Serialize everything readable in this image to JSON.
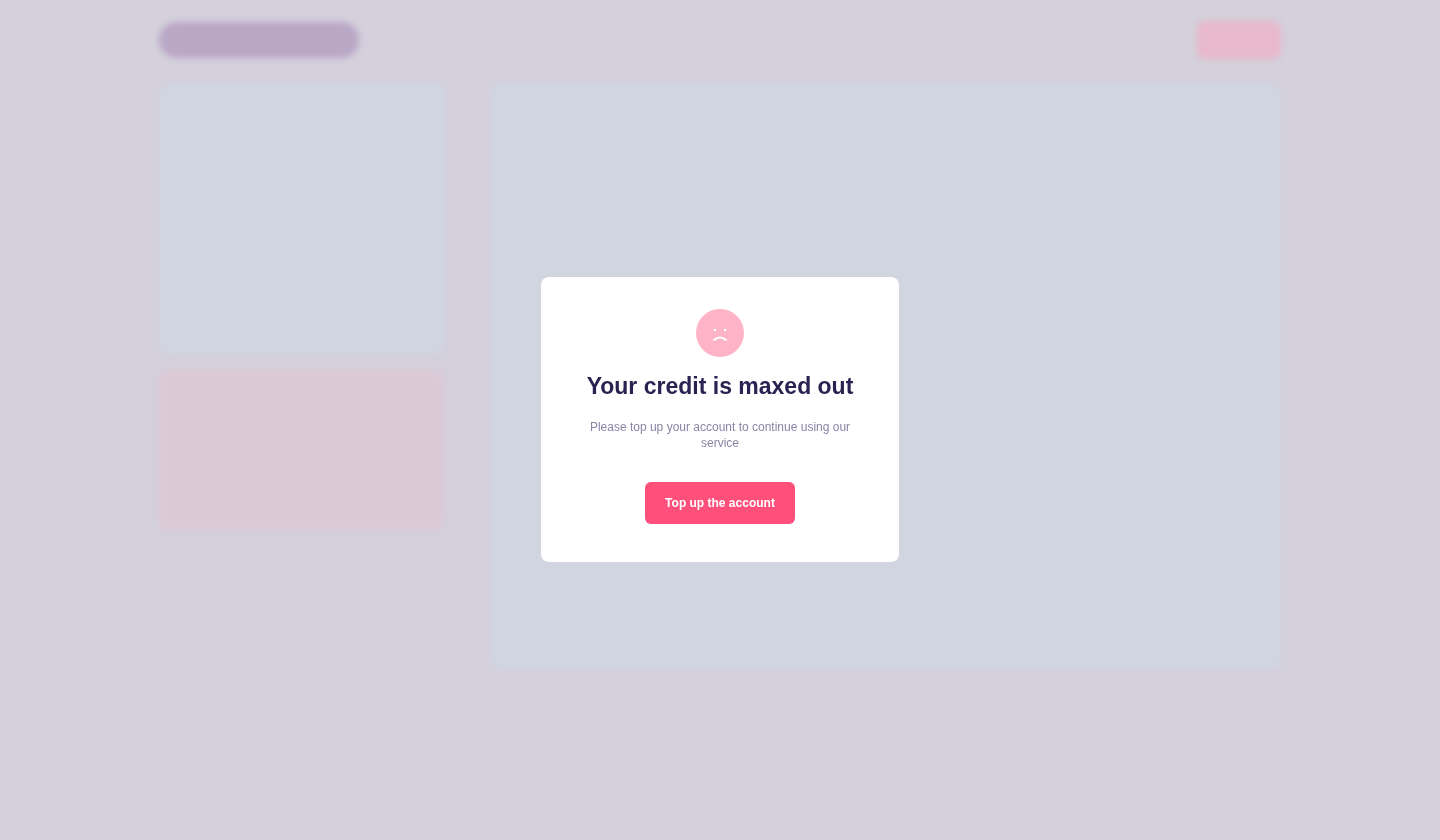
{
  "modal": {
    "title": "Your credit is maxed out",
    "message": "Please top up your account to continue using our service",
    "button": "Top up the account"
  }
}
